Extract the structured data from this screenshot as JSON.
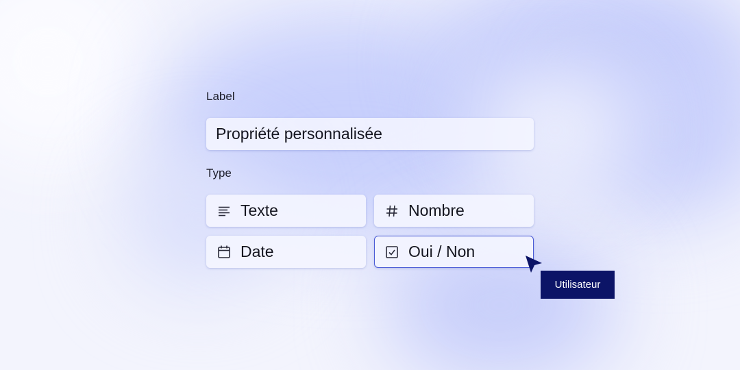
{
  "form": {
    "label_heading": "Label",
    "label_value": "Propriété personnalisée",
    "type_heading": "Type",
    "types": [
      {
        "label": "Texte",
        "icon": "text-lines-icon"
      },
      {
        "label": "Nombre",
        "icon": "hash-icon"
      },
      {
        "label": "Date",
        "icon": "calendar-icon"
      },
      {
        "label": "Oui / Non",
        "icon": "checkbox-icon"
      }
    ]
  },
  "cursor": {
    "tooltip": "Utilisateur"
  },
  "colors": {
    "accent": "#4a5bd6",
    "cursor": "#0c1467",
    "text": "#14151f"
  }
}
